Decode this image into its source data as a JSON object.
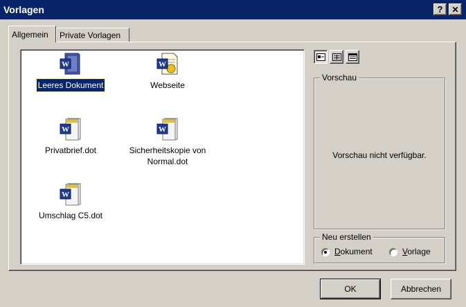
{
  "window": {
    "title": "Vorlagen",
    "help_label": "?",
    "close_label": "✕"
  },
  "tabs": [
    {
      "label": "Allgemein",
      "active": true
    },
    {
      "label": "Private Vorlagen",
      "active": false
    }
  ],
  "templates": [
    {
      "label": "Leeres Dokument",
      "icon": "word-document-icon",
      "selected": true
    },
    {
      "label": "Webseite",
      "icon": "word-webpage-icon",
      "selected": false
    },
    {
      "label": "Privatbrief.dot",
      "icon": "word-template-icon",
      "selected": false
    },
    {
      "label": "Sicherheitskopie von Normal.dot",
      "icon": "word-template-icon",
      "selected": false
    },
    {
      "label": "Umschlag C5.dot",
      "icon": "word-template-icon",
      "selected": false
    }
  ],
  "view_buttons": [
    {
      "name": "large-icons-view-icon",
      "pressed": true
    },
    {
      "name": "list-view-icon",
      "pressed": false
    },
    {
      "name": "details-view-icon",
      "pressed": false
    }
  ],
  "preview": {
    "legend": "Vorschau",
    "message": "Vorschau nicht verfügbar."
  },
  "create_new": {
    "legend": "Neu erstellen",
    "options": [
      {
        "label": "Dokument",
        "accel": "D",
        "rest": "okument",
        "checked": true
      },
      {
        "label": "Vorlage",
        "accel": "V",
        "rest": "orlage",
        "checked": false
      }
    ]
  },
  "buttons": {
    "ok": "OK",
    "cancel": "Abbrechen"
  },
  "colors": {
    "titlebar": "#0a246a",
    "face": "#d4d0c8",
    "word_blue": "#1f3a93"
  }
}
